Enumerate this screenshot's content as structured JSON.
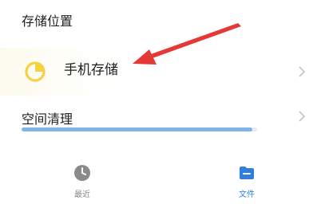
{
  "storage": {
    "section_title": "存储位置",
    "phone_storage_label": "手机存储"
  },
  "cleanup": {
    "label": "空间清理",
    "usage_fraction": 0.98
  },
  "bottom_nav": {
    "recent_label": "最近",
    "files_label": "文件"
  },
  "icons": {
    "storage": "pie-chart-icon",
    "chevron": "chevron-right-icon",
    "recent": "clock-icon",
    "files": "folder-icon"
  },
  "colors": {
    "pie_icon": "#f5d23f",
    "progress": "#80b4e8",
    "annotation": "#e53935",
    "active_nav": "#2f7fe0",
    "inactive_nav": "#8a8a8a"
  }
}
